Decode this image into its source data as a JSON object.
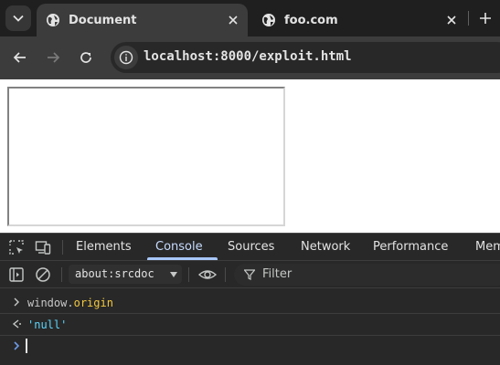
{
  "browser": {
    "tabs": [
      {
        "title": "Document",
        "active": true,
        "icon": "globe-icon"
      },
      {
        "title": "foo.com",
        "active": false,
        "icon": "globe-icon"
      }
    ],
    "url": "localhost:8000/exploit.html"
  },
  "devtools": {
    "tabs": [
      "Elements",
      "Console",
      "Sources",
      "Network",
      "Performance",
      "Memo"
    ],
    "active_tab": "Console",
    "context": "about:srcdoc",
    "filter_placeholder": "Filter",
    "console": {
      "input_object": "window",
      "input_dot": ".",
      "input_property": "origin",
      "result": "'null'"
    }
  },
  "colors": {
    "tab_strip": "#1f1f1f",
    "toolbar": "#3c3c3c",
    "devtools_bg": "#282828",
    "active_accent": "#a8c7fa",
    "property_yellow": "#f2c83d",
    "string_cyan": "#5cd5fb"
  }
}
